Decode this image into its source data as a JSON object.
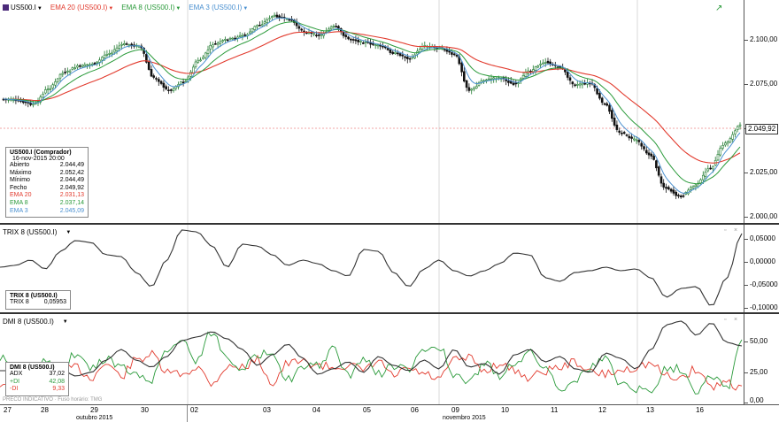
{
  "main": {
    "legend": {
      "symbol": "US500.I",
      "ema20": "EMA 20 (US500.I)",
      "ema8": "EMA 8 (US500.I)",
      "ema3": "EMA 3 (US500.I)"
    },
    "yaxis": [
      "2.100,00",
      "2.075,00",
      "2.050,00",
      "2.025,00",
      "2.000,00"
    ],
    "price_marker": "2.049,92",
    "info": {
      "title": "US500.I (Comprador)",
      "datetime": "16-nov-2015 20:00",
      "rows": [
        {
          "label": "Abierto",
          "value": "2.044,49"
        },
        {
          "label": "Máximo",
          "value": "2.052,42"
        },
        {
          "label": "Mínimo",
          "value": "2.044,49"
        },
        {
          "label": "Fecho",
          "value": "2.049,92"
        },
        {
          "label": "EMA 20",
          "value": "2.031,13"
        },
        {
          "label": "EMA 8",
          "value": "2.037,14"
        },
        {
          "label": "EMA 3",
          "value": "2.045,09"
        }
      ]
    },
    "colors": {
      "ema20": "#e23b2e",
      "ema8": "#2a9a3a",
      "ema3": "#4a90d0",
      "up": "#1f7a2e",
      "down": "#111111"
    }
  },
  "trix": {
    "legend": "TRIX 8 (US500.I)",
    "yaxis": [
      "0,05000",
      "0,00000",
      "-0,05000",
      "-0,10000"
    ],
    "info": {
      "title": "TRIX 8 (US500.I)",
      "rows": [
        {
          "label": "TRIX 8",
          "value": "0,05953"
        }
      ]
    }
  },
  "dmi": {
    "legend": "DMI 8 (US500.I)",
    "yaxis": [
      "50,00",
      "25,00",
      "0,00"
    ],
    "info": {
      "title": "DMI 8 (US500.I)",
      "rows": [
        {
          "label": "ADX",
          "value": "37,02"
        },
        {
          "label": "+DI",
          "value": "42,08"
        },
        {
          "label": "-DI",
          "value": "9,33"
        }
      ]
    },
    "watermark": "PRECO INDICATIVO · Fuso horário: TMG"
  },
  "xaxis": {
    "days": [
      "27",
      "28",
      "29",
      "30",
      "02",
      "03",
      "04",
      "05",
      "06",
      "09",
      "10",
      "11",
      "12",
      "13",
      "16"
    ],
    "months": [
      "outubro 2015",
      "novembro 2015"
    ]
  }
}
